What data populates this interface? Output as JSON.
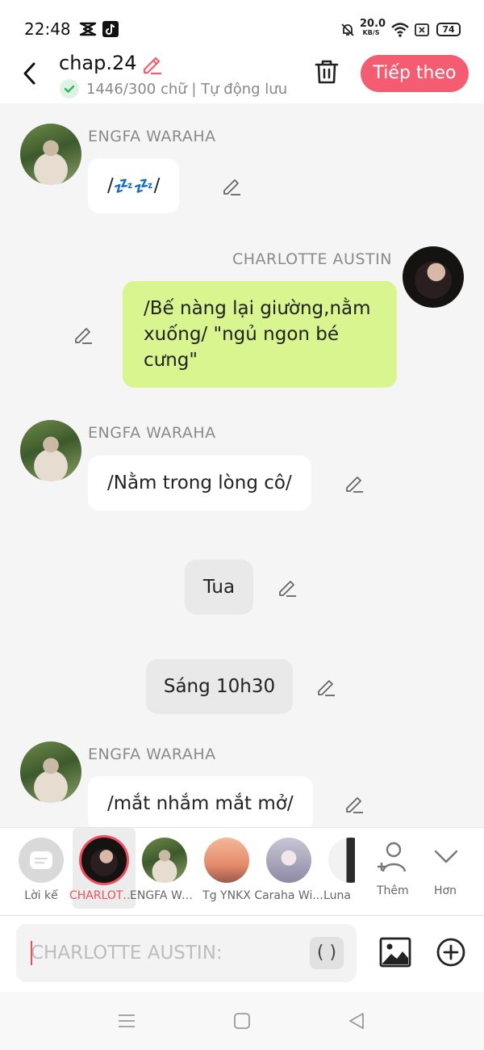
{
  "status_bar": {
    "time": "22:48",
    "net_speed_value": "20.0",
    "net_speed_unit": "KB/S",
    "battery": "74"
  },
  "header": {
    "title": "chap.24",
    "subtitle": "1446/300 chữ | Tự động lưu",
    "next_label": "Tiếp theo"
  },
  "messages": [
    {
      "speaker": "ENGFA WARAHA",
      "text_prefix": "/",
      "text_suffix": "/",
      "emoji": "💤💤"
    },
    {
      "speaker": "CHARLOTTE AUSTIN",
      "text": "/Bế nàng lại giường,nằm xuống/ \"ngủ ngon bé cưng\""
    },
    {
      "speaker": "ENGFA WARAHA",
      "text": "/Nằm trong lòng cô/"
    },
    {
      "narration": "Tua"
    },
    {
      "narration": "Sáng 10h30"
    },
    {
      "speaker": "ENGFA WARAHA",
      "text": "/mắt nhắm mắt mở/"
    }
  ],
  "character_bar": {
    "items": [
      {
        "label": "Lời kể"
      },
      {
        "label": "CHARLOTTE AUSTIN"
      },
      {
        "label": "ENGFA WARAHA"
      },
      {
        "label": "Tg YNKX"
      },
      {
        "label": "Caraha Wi..."
      },
      {
        "label": "Luna"
      }
    ],
    "add_label": "Thêm",
    "more_label": "Hơn"
  },
  "input": {
    "placeholder": "CHARLOTTE AUSTIN:",
    "paren_label": "( )"
  },
  "colors": {
    "accent": "#f45c72",
    "green_bubble": "#d8f58f",
    "selected_label": "#f04e5f"
  },
  "icons": [
    "capcut-icon",
    "tiktok-icon",
    "bell-off-icon",
    "wifi-icon",
    "sim-icon",
    "back-icon",
    "edit-icon",
    "check-icon",
    "trash-icon",
    "pencil-icon",
    "add-person-icon",
    "chevron-down-icon",
    "image-icon",
    "plus-circle-icon",
    "menu-icon",
    "home-square-icon",
    "back-triangle-icon"
  ]
}
